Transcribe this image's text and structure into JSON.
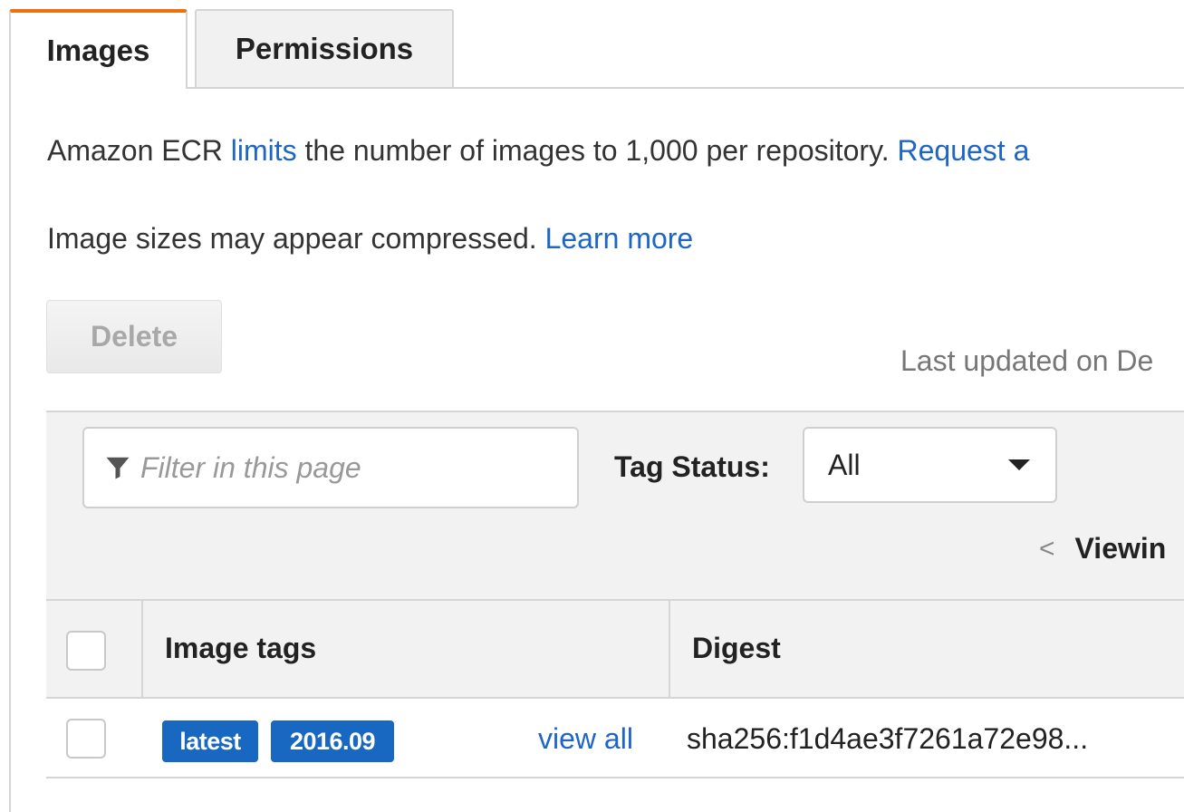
{
  "tabs": [
    {
      "label": "Images",
      "active": true
    },
    {
      "label": "Permissions",
      "active": false
    }
  ],
  "info": {
    "line1_prefix": "Amazon ECR ",
    "line1_link": "limits",
    "line1_middle": " the number of images to 1,000 per repository. ",
    "line1_link2": "Request a",
    "line2_text": "Image sizes may appear compressed. ",
    "line2_link": "Learn more"
  },
  "toolbar": {
    "delete_label": "Delete",
    "last_updated": "Last updated on De"
  },
  "filter": {
    "placeholder": "Filter in this page",
    "icon": "funnel-icon",
    "tag_status_label": "Tag Status:",
    "tag_status_value": "All"
  },
  "pager": {
    "prev_symbol": "<",
    "viewing_label": "Viewin"
  },
  "table": {
    "columns": [
      "Image tags",
      "Digest"
    ],
    "rows": [
      {
        "tags": [
          "latest",
          "2016.09"
        ],
        "view_all": "view all",
        "digest": "sha256:f1d4ae3f7261a72e98..."
      }
    ]
  },
  "colors": {
    "accent_tab": "#ec7211",
    "link": "#1d65c6",
    "tag_badge": "#1867c0"
  }
}
